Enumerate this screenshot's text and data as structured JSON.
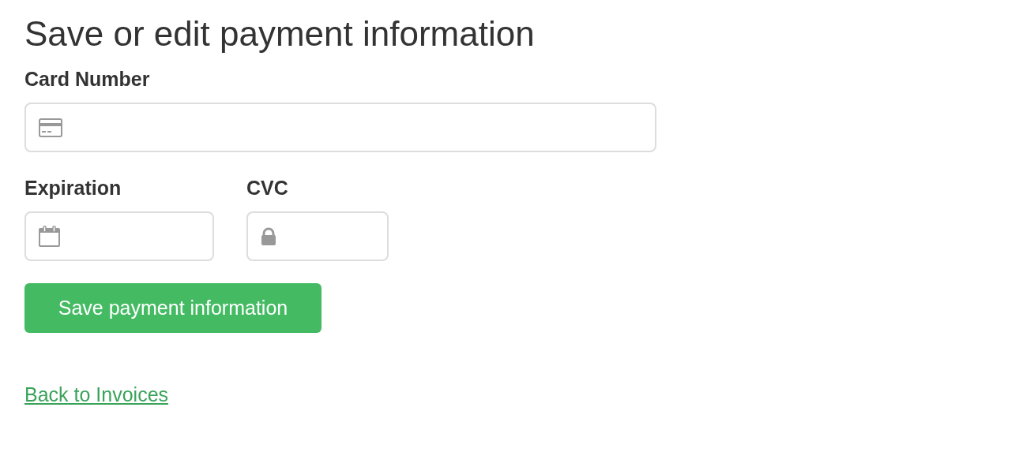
{
  "heading": "Save or edit payment information",
  "fields": [
    {
      "label": "Card Number"
    },
    {
      "label": "Expiration"
    },
    {
      "label": "CVC"
    }
  ],
  "submit_button": "Save payment information",
  "back_link": "Back to Invoices"
}
